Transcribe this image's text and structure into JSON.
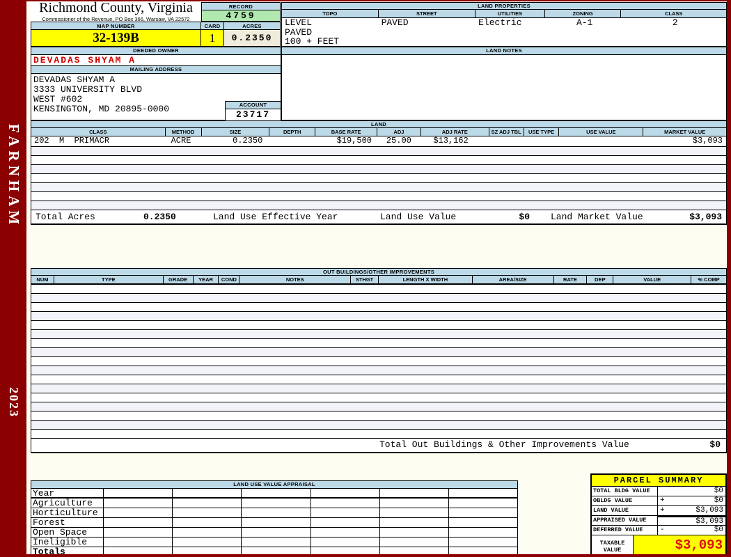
{
  "colors": {
    "frame_red": "#8b0000",
    "header_band_blue": "#bcd9e8",
    "record_green": "#b0e8b0",
    "highlight_yellow": "#ffff00",
    "acres_beige": "#f0ecdb",
    "owner_name_red": "#cc0000",
    "taxable_value_red": "#dd1111"
  },
  "sidebar": {
    "district": "FARNHAM",
    "year": "2023"
  },
  "header": {
    "county_title": "Richmond County, Virginia",
    "commissioner_line": "Commissioner of the Revenue, PO Box 366, Warsaw, VA 22572",
    "record_label": "RECORD",
    "record_value": "4759",
    "map_number_label": "MAP NUMBER",
    "map_number_value": "32-139B",
    "card_label": "CARD",
    "card_value": "1",
    "acres_label": "ACRES",
    "acres_value": "0.2350"
  },
  "land_properties": {
    "title": "LAND PROPERTIES",
    "columns": [
      "TOPO",
      "STREET",
      "UTILITIES",
      "ZONING",
      "CLASS"
    ],
    "values": [
      "LEVEL",
      "PAVED",
      "Electric",
      "A-1",
      "2"
    ],
    "extra_lines": [
      "PAVED",
      "100 + FEET"
    ]
  },
  "owner": {
    "deeded_owner_label": "DEEDED OWNER",
    "deeded_owner": "DEVADAS SHYAM A",
    "mailing_address_label": "MAILING ADDRESS",
    "address_lines": [
      "DEVADAS SHYAM A",
      "3333 UNIVERSITY BLVD",
      "WEST #602",
      "KENSINGTON, MD 20895-0000"
    ],
    "account_label": "ACCOUNT",
    "account_value": "23717"
  },
  "land_notes": {
    "title": "LAND NOTES",
    "content": ""
  },
  "land_table": {
    "title": "LAND",
    "columns": [
      "CLASS",
      "METHOD",
      "SIZE",
      "DEPTH",
      "BASE RATE",
      "ADJ",
      "ADJ RATE",
      "SZ ADJ TBL",
      "USE TYPE",
      "USE VALUE",
      "MARKET VALUE"
    ],
    "rows": [
      [
        "202  M  PRIMACR",
        "ACRE",
        "0.2350",
        "",
        "$19,500",
        "25.00",
        "$13,162",
        "",
        "",
        "",
        "$3,093"
      ]
    ],
    "empty_row_count": 7,
    "totals": {
      "total_acres_label": "Total Acres",
      "total_acres_value": "0.2350",
      "effective_year_label": "Land Use Effective Year",
      "land_use_value_label": "Land Use Value",
      "land_use_value": "$0",
      "land_market_value_label": "Land Market Value",
      "land_market_value": "$3,093"
    }
  },
  "out_buildings": {
    "title": "OUT BUILDINGS/OTHER IMPROVEMENTS",
    "columns": [
      "NUM",
      "TYPE",
      "GRADE",
      "YEAR",
      "COND",
      "NOTES",
      "STHGT",
      "LENGTH X WIDTH",
      "AREA/SIZE",
      "RATE",
      "DEP",
      "VALUE",
      "% COMP"
    ],
    "empty_row_count": 17,
    "total_label": "Total Out Buildings & Other Improvements Value",
    "total_value": "$0"
  },
  "land_use_appraisal": {
    "title": "LAND USE VALUE APPRAISAL",
    "row_labels": [
      "Year",
      "Agriculture",
      "Horticulture",
      "Forest",
      "Open Space",
      "Ineligible",
      "Totals"
    ],
    "data_column_count": 6
  },
  "parcel_summary": {
    "title": "PARCEL SUMMARY",
    "rows": [
      {
        "label": "TOTAL BLDG VALUE",
        "op": "",
        "value": "$0"
      },
      {
        "label": "OBLDG VALUE",
        "op": "+",
        "value": "$0"
      },
      {
        "label": "LAND VALUE",
        "op": "+",
        "value": "$3,093"
      },
      {
        "label": "APPRAISED VALUE",
        "op": "",
        "value": "$3,093"
      },
      {
        "label": "DEFERRED VALUE",
        "op": "-",
        "value": "$0"
      }
    ],
    "taxable_label": "TAXABLE VALUE",
    "taxable_value": "$3,093"
  }
}
